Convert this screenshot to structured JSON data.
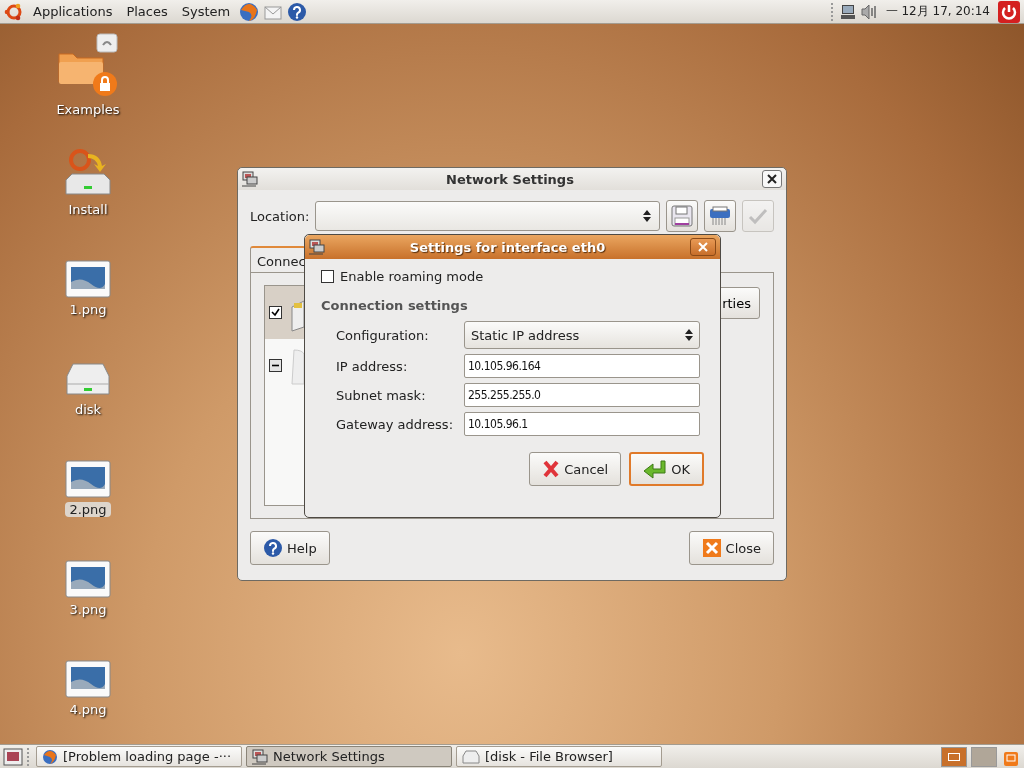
{
  "top_panel": {
    "menus": [
      "Applications",
      "Places",
      "System"
    ],
    "clock": "一 12月 17, 20:14"
  },
  "desktop_icons": [
    {
      "label": "Examples",
      "kind": "folder",
      "selected": false
    },
    {
      "label": "Install",
      "kind": "installer",
      "selected": false
    },
    {
      "label": "1.png",
      "kind": "image",
      "selected": false
    },
    {
      "label": "disk",
      "kind": "drive",
      "selected": false
    },
    {
      "label": "2.png",
      "kind": "image",
      "selected": true
    },
    {
      "label": "3.png",
      "kind": "image",
      "selected": false
    },
    {
      "label": "4.png",
      "kind": "image",
      "selected": false
    }
  ],
  "network_window": {
    "title": "Network Settings",
    "location_label": "Location:",
    "toolbar": [
      {
        "kind": "save",
        "disabled": false
      },
      {
        "kind": "delete",
        "disabled": false
      },
      {
        "kind": "apply",
        "disabled": true
      }
    ],
    "tabs": [
      {
        "label": "Connec",
        "selected": true
      }
    ],
    "connections": [
      {
        "kind": "ethernet",
        "checked": true,
        "inconsistent": false,
        "selected": true
      },
      {
        "kind": "modem",
        "checked": true,
        "inconsistent": true,
        "selected": false
      }
    ],
    "partial_button": "rties",
    "help_button": "Help",
    "close_button": "Close"
  },
  "dialog": {
    "title": "Settings for interface eth0",
    "roaming": {
      "label": "Enable roaming mode",
      "checked": false
    },
    "section": "Connection settings",
    "configuration": {
      "label": "Configuration:",
      "value": "Static IP address"
    },
    "fields": [
      {
        "label": "IP address:",
        "value": "10.105.96.164"
      },
      {
        "label": "Subnet mask:",
        "value": "255.255.255.0"
      },
      {
        "label": "Gateway address:",
        "value": "10.105.96.1"
      }
    ],
    "cancel_button": "Cancel",
    "ok_button": "OK"
  },
  "taskbar": {
    "tasks": [
      {
        "label": "[Problem loading page -···",
        "kind": "browser",
        "selected": false
      },
      {
        "label": "Network Settings",
        "kind": "network",
        "selected": true
      },
      {
        "label": "[disk - File Browser]",
        "kind": "drive",
        "selected": false
      }
    ],
    "workspaces": [
      {
        "selected": true
      },
      {
        "selected": false
      }
    ]
  }
}
